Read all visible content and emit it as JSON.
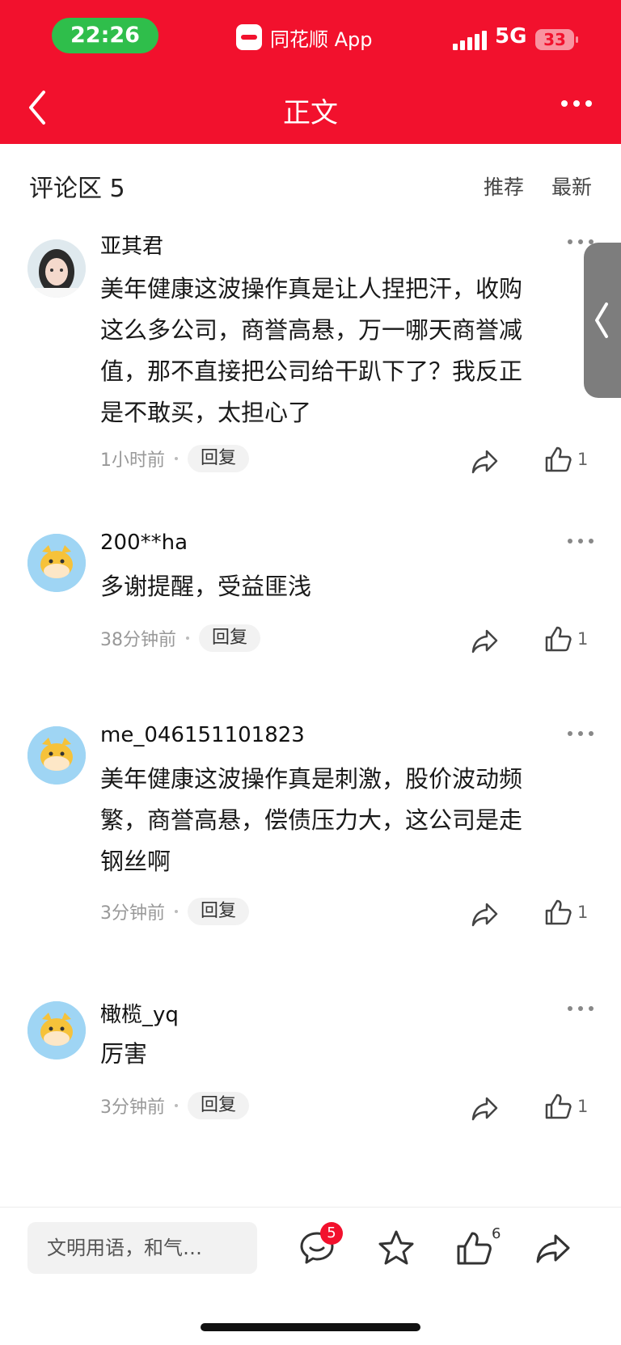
{
  "status_bar": {
    "time": "22:26",
    "app_name": "同花顺 App",
    "network": "5G",
    "battery": "33"
  },
  "nav": {
    "title": "正文"
  },
  "comments_section": {
    "title": "评论区 5",
    "sort_tabs": [
      "推荐",
      "最新"
    ],
    "comments": [
      {
        "username": "亚其君",
        "avatar": "photo-avatar",
        "lines": [
          "美年健康这波操作真是让人捏把汗，收购",
          "这么多公司，商誉高悬，万一哪天商誉减",
          "值，那不直接把公司给干趴下了？我反正",
          "是不敢买，太担心了"
        ],
        "time": "1小时前",
        "reply_label": "回复",
        "likes": "1"
      },
      {
        "username": "200**ha",
        "avatar": "cow-avatar",
        "lines": [
          "多谢提醒，受益匪浅"
        ],
        "time": "38分钟前",
        "reply_label": "回复",
        "likes": "1"
      },
      {
        "username": "me_046151101823",
        "avatar": "cow-avatar",
        "lines": [
          "美年健康这波操作真是刺激，股价波动频",
          "繁，商誉高悬，偿债压力大，这公司是走",
          "钢丝啊"
        ],
        "time": "3分钟前",
        "reply_label": "回复",
        "likes": "1"
      },
      {
        "username": "橄榄_yq",
        "avatar": "cow-avatar",
        "lines": [
          "厉害"
        ],
        "time": "3分钟前",
        "reply_label": "回复",
        "likes": "1"
      }
    ]
  },
  "bottom_bar": {
    "input_placeholder": "文明用语，和气…",
    "comment_badge": "5",
    "like_count": "6",
    "icons": [
      "comment-icon",
      "star-icon",
      "thumbs-up-icon",
      "share-icon"
    ]
  },
  "colors": {
    "brand_red": "#f2112d",
    "time_green": "#2fbe4b",
    "cow_bg": "#9fd5f4"
  }
}
